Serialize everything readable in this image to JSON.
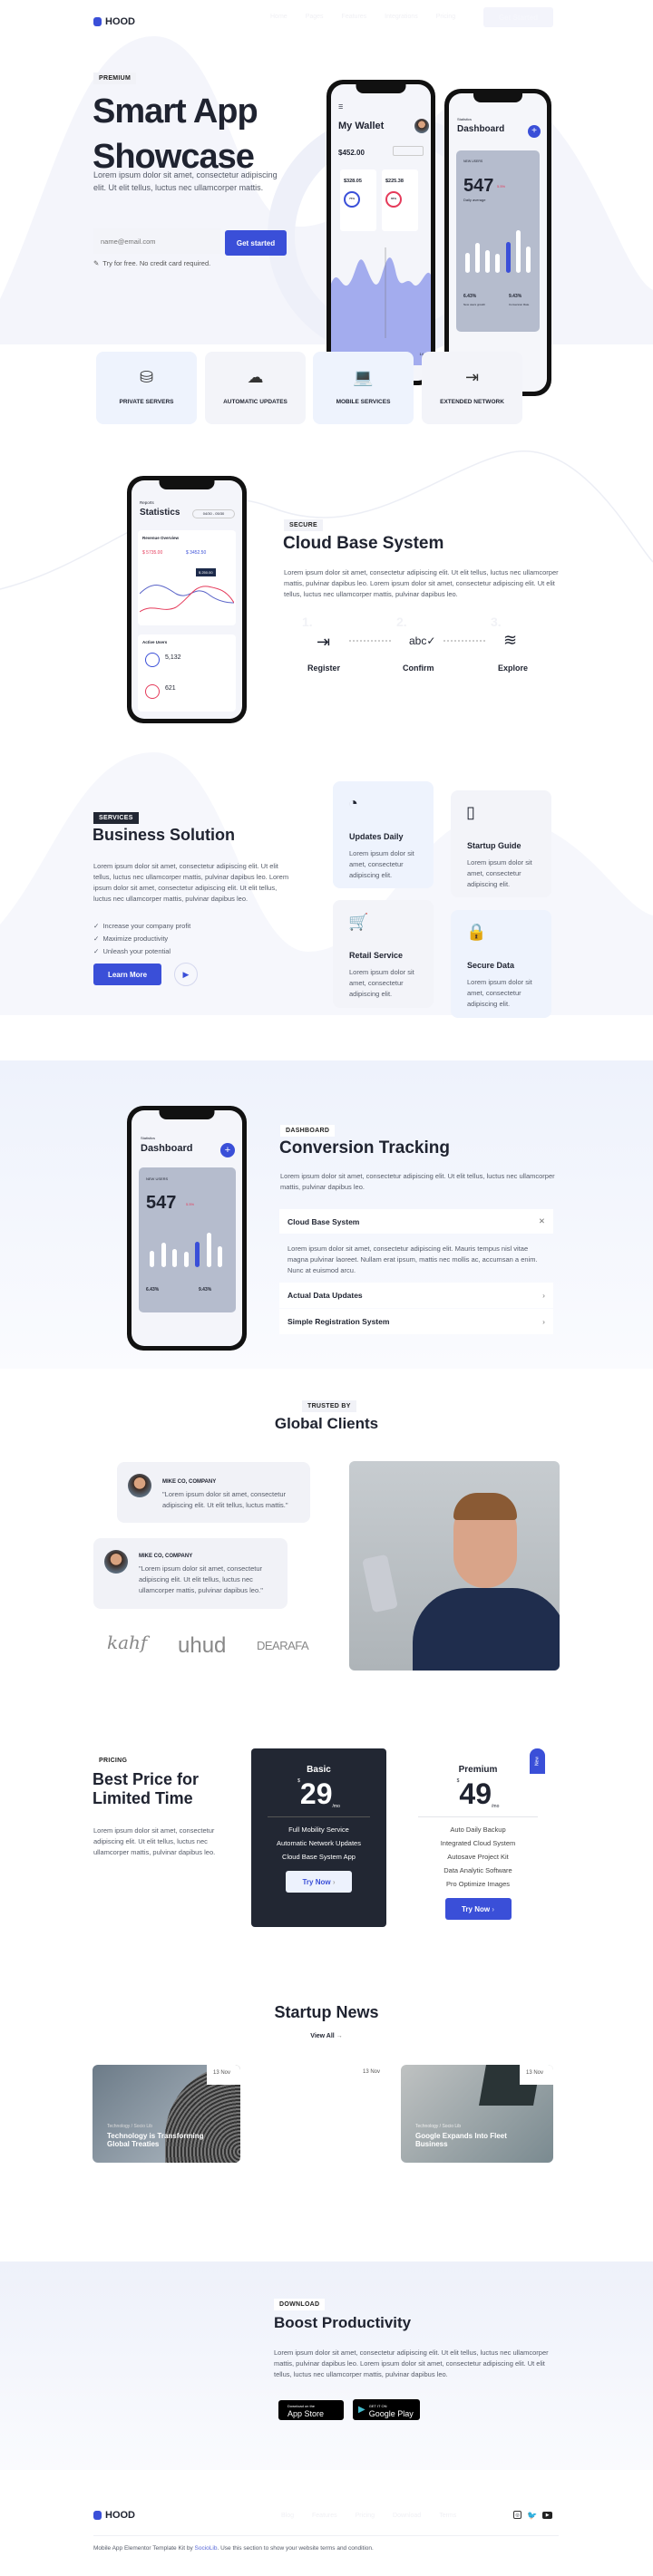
{
  "brand": {
    "name": "HOOD",
    "accent": "#3a4fd8",
    "dark": "#222733"
  },
  "nav": {
    "items": [
      "Home",
      "Pages",
      "Features",
      "Integrations",
      "Pricing"
    ],
    "cta": "Get Started"
  },
  "hero": {
    "badge": "PREMIUM",
    "title_line1": "Smart App",
    "title_line2": "Showcase",
    "text": "Lorem ipsum dolor sit amet, consectetur adipiscing elit. Ut elit tellus, luctus nec ullamcorper mattis.",
    "email_placeholder": "name@email.com",
    "button": "Get started",
    "note": "Try for free. No credit card required.",
    "wallet": {
      "title": "My Wallet",
      "amount": "$452.00",
      "income": "$328.05",
      "expenses": "$225.38",
      "income_pct": "75%",
      "expense_pct": "65%",
      "days": [
        "8",
        "9",
        "10",
        "11",
        "12",
        "13",
        "14"
      ]
    },
    "dashboard": {
      "label": "Statistics",
      "title": "Dashboard",
      "card_label": "NEW USERS",
      "value": "547",
      "change": "5.5%",
      "sub": "Daily average",
      "stat1": "6.43%",
      "stat1_label": "New users growth",
      "stat2": "9.43%",
      "stat2_label": "Conversion Rate",
      "bars": [
        0.4,
        0.6,
        0.45,
        0.38,
        0.62,
        0.85,
        0.52
      ]
    }
  },
  "features": [
    {
      "icon": "database-icon",
      "label": "PRIVATE SERVERS"
    },
    {
      "icon": "cloud-download-icon",
      "label": "AUTOMATIC UPDATES"
    },
    {
      "icon": "devices-icon",
      "label": "MOBILE SERVICES"
    },
    {
      "icon": "door-exit-icon",
      "label": "EXTENDED NETWORK"
    }
  ],
  "secure": {
    "badge": "SECURE",
    "title": "Cloud Base System",
    "text": "Lorem ipsum dolor sit amet, consectetur adipiscing elit. Ut elit tellus, luctus nec ullamcorper mattis, pulvinar dapibus leo. Lorem ipsum dolor sit amet, consectetur adipiscing elit. Ut elit tellus, luctus nec ullamcorper mattis, pulvinar dapibus leo.",
    "steps": [
      {
        "num": "1.",
        "label": "Register",
        "icon": "login-icon"
      },
      {
        "num": "2.",
        "label": "Confirm",
        "icon": "spellcheck-icon"
      },
      {
        "num": "3.",
        "label": "Explore",
        "icon": "layers-icon"
      }
    ],
    "phone": {
      "label": "Reports",
      "title": "Statistics",
      "range": "04/30 - 05/30",
      "chart_title": "Revenue Overview",
      "v1": "$ 5735.00",
      "v2": "$ 3452.50",
      "tooltip": "$ 250.00",
      "users_title": "Active Users",
      "users1": "5,132",
      "users2": "621"
    }
  },
  "services": {
    "badge": "SERVICES",
    "title": "Business Solution",
    "text": "Lorem ipsum dolor sit amet, consectetur adipiscing elit. Ut elit tellus, luctus nec ullamcorper mattis, pulvinar dapibus leo. Lorem ipsum dolor sit amet, consectetur adipiscing elit. Ut elit tellus, luctus nec ullamcorper mattis, pulvinar dapibus leo.",
    "checklist": [
      "Increase your company profit",
      "Maximize productivity",
      "Unleash your potential"
    ],
    "button": "Learn More",
    "cards": [
      {
        "title": "Updates Daily",
        "text": "Lorem ipsum dolor sit amet, consectetur adipiscing elit.",
        "icon": "pie-chart-icon"
      },
      {
        "title": "Startup Guide",
        "text": "Lorem ipsum dolor sit amet, consectetur adipiscing elit.",
        "icon": "book-icon"
      },
      {
        "title": "Retail Service",
        "text": "Lorem ipsum dolor sit amet, consectetur adipiscing elit.",
        "icon": "cart-icon"
      },
      {
        "title": "Secure Data",
        "text": "Lorem ipsum dolor sit amet, consectetur adipiscing elit.",
        "icon": "lock-icon"
      }
    ]
  },
  "conversion": {
    "badge": "DASHBOARD",
    "title": "Conversion Tracking",
    "text": "Lorem ipsum dolor sit amet, consectetur adipiscing elit. Ut elit tellus, luctus nec ullamcorper mattis, pulvinar dapibus leo.",
    "accordion": [
      {
        "title": "Cloud Base System",
        "body": "Lorem ipsum dolor sit amet, consectetur adipiscing elit. Mauris tempus nisl vitae magna pulvinar laoreet. Nullam erat ipsum, mattis nec mollis ac, accumsan a enim. Nunc at euismod arcu.",
        "open": true
      },
      {
        "title": "Actual Data Updates",
        "open": false
      },
      {
        "title": "Simple Registration System",
        "open": false
      }
    ]
  },
  "clients": {
    "badge": "TRUSTED BY",
    "title": "Global Clients",
    "testimonials": [
      {
        "name": "MIKE CO, COMPANY",
        "quote": "\"Lorem ipsum dolor sit amet, consectetur adipiscing elit. Ut elit tellus, luctus mattis.\""
      },
      {
        "name": "MIKE CO, COMPANY",
        "quote": "\"Lorem ipsum dolor sit amet, consectetur adipiscing elit. Ut elit tellus, luctus nec ullamcorper mattis, pulvinar dapibus leo.\""
      }
    ],
    "logos": [
      "kahf",
      "uhud",
      "DEARAFA"
    ]
  },
  "pricing": {
    "badge": "PRICING",
    "title_line1": "Best Price for",
    "title_line2": "Limited Time",
    "text": "Lorem ipsum dolor sit amet, consectetur adipiscing elit. Ut elit tellus, luctus nec ullamcorper mattis, pulvinar dapibus leo.",
    "plans": [
      {
        "name": "Basic",
        "currency": "$",
        "price": "29",
        "period": "/mo",
        "features": [
          "Full Mobility Service",
          "Automatic Network Updates",
          "Cloud Base System App"
        ],
        "button": "Try Now"
      },
      {
        "name": "Premium",
        "currency": "$",
        "price": "49",
        "period": "/mo",
        "tag": "New",
        "features": [
          "Auto Daily Backup",
          "Integrated Cloud System",
          "Autosave Project Kit",
          "Data Analytic Software",
          "Pro Optimize Images"
        ],
        "button": "Try Now"
      }
    ]
  },
  "news": {
    "title": "Startup News",
    "view_all": "View All",
    "arrow": "→",
    "items": [
      {
        "date": "13 Nov",
        "category": "Technology  /  Socio Lib",
        "title": "Technology is Transforming Global Treaties"
      },
      {
        "date": "13 Nov"
      },
      {
        "date": "13 Nov",
        "category": "Technology  /  Socio Lib",
        "title": "Google Expands Into Fleet Business"
      }
    ]
  },
  "download": {
    "badge": "DOWNLOAD",
    "title": "Boost Productivity",
    "text": "Lorem ipsum dolor sit amet, consectetur adipiscing elit. Ut elit tellus, luctus nec ullamcorper mattis, pulvinar dapibus leo. Lorem ipsum dolor sit amet, consectetur adipiscing elit. Ut elit tellus, luctus nec ullamcorper mattis, pulvinar dapibus leo.",
    "appstore_small": "Download on the",
    "appstore": "App Store",
    "play_small": "GET IT ON",
    "play": "Google Play"
  },
  "footer": {
    "brand": "HOOD",
    "links": [
      "Blog",
      "Features",
      "Pricing",
      "Download",
      "Terms"
    ],
    "text_before": "Mobile App Elementor Template Kit by ",
    "link": "SocioLib",
    "text_after": ". Use this section to show your website terms and condition.",
    "social": [
      "instagram-icon",
      "twitter-icon",
      "youtube-icon"
    ]
  }
}
